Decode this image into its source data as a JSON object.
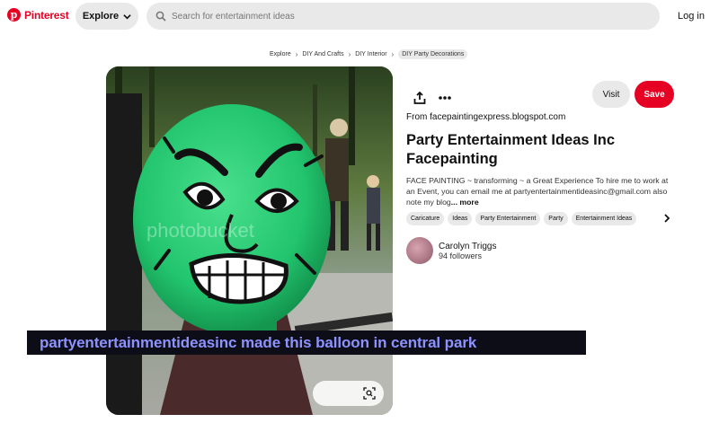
{
  "header": {
    "logo_text": "Pinterest",
    "explore_label": "Explore",
    "search_placeholder": "Search for entertainment ideas",
    "login_label": "Log in"
  },
  "breadcrumb": [
    "Explore",
    "DIY And Crafts",
    "DIY Interior",
    "DIY Party Decorations"
  ],
  "pin": {
    "visit_label": "Visit",
    "save_label": "Save",
    "source_prefix": "From ",
    "source_domain": "facepaintingexpress.blogspot.com",
    "title": "Party Entertainment Ideas Inc Facepainting",
    "description": "FACE PAINTING ~ transforming ~ a Great Experience To hire me to work at an Event, you can email me at partyentertainmentideasinc@gmail.com also note my blog",
    "more_label": "... more",
    "tags": [
      "Caricature",
      "Ideas",
      "Party Entertainment",
      "Party",
      "Entertainment Ideas"
    ],
    "author": {
      "name": "Carolyn Triggs",
      "followers": "94 followers"
    },
    "watermark": "photobucket"
  },
  "caption": "partyentertainmentideasinc made this balloon in central park",
  "colors": {
    "brand": "#e60023",
    "caption_text": "#8d92ff",
    "balloon": "#2ecc7a"
  }
}
